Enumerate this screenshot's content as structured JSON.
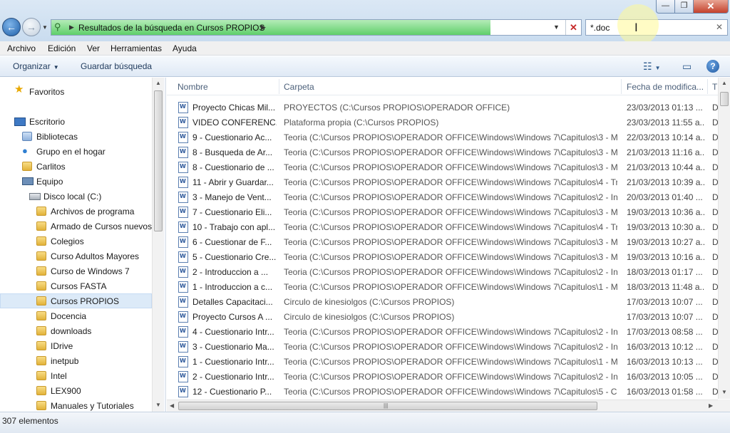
{
  "window": {
    "minimize_glyph": "—",
    "maximize_glyph": "❐",
    "close_glyph": "✕"
  },
  "navigation": {
    "back_glyph": "←",
    "forward_glyph": "→",
    "recent_glyph": "▼"
  },
  "address": {
    "icon": "search-folder-icon",
    "path_text": "Resultados de la búsqueda en Cursos PROPIOS",
    "separator": "▶",
    "dropdown_glyph": "▼",
    "stop_glyph": "✕"
  },
  "search": {
    "value": "*.doc",
    "clear_glyph": "✕"
  },
  "menu": [
    "Archivo",
    "Edición",
    "Ver",
    "Herramientas",
    "Ayuda"
  ],
  "commands": {
    "organize": "Organizar",
    "save_search": "Guardar búsqueda",
    "dropdown_glyph": "▼",
    "views_glyph": "☷",
    "preview_glyph": "▭",
    "help_glyph": "?"
  },
  "nav_tree": [
    {
      "label": "Favoritos",
      "icon": "star-icon"
    },
    {
      "label": "Escritorio",
      "icon": "desktop-icon"
    },
    {
      "label": "Bibliotecas",
      "icon": "libraries-icon"
    },
    {
      "label": "Grupo en el hogar",
      "icon": "homegroup-icon"
    },
    {
      "label": "Carlitos",
      "icon": "user-folder-icon"
    },
    {
      "label": "Equipo",
      "icon": "computer-icon"
    },
    {
      "label": "Disco local (C:)",
      "icon": "drive-icon"
    },
    {
      "label": "Archivos de programa",
      "icon": "folder-icon"
    },
    {
      "label": "Armado de Cursos nuevos",
      "icon": "folder-icon"
    },
    {
      "label": "Colegios",
      "icon": "folder-icon"
    },
    {
      "label": "Curso Adultos Mayores",
      "icon": "folder-icon"
    },
    {
      "label": "Curso de Windows 7",
      "icon": "folder-icon"
    },
    {
      "label": "Cursos FASTA",
      "icon": "folder-icon"
    },
    {
      "label": "Cursos PROPIOS",
      "icon": "folder-icon",
      "selected": true
    },
    {
      "label": "Docencia",
      "icon": "folder-icon"
    },
    {
      "label": "downloads",
      "icon": "folder-icon"
    },
    {
      "label": "IDrive",
      "icon": "folder-icon"
    },
    {
      "label": "inetpub",
      "icon": "folder-icon"
    },
    {
      "label": "Intel",
      "icon": "folder-icon"
    },
    {
      "label": "LEX900",
      "icon": "folder-icon"
    },
    {
      "label": "Manuales y Tutoriales",
      "icon": "folder-icon"
    }
  ],
  "columns": [
    "Nombre",
    "Carpeta",
    "Fecha de modifica...",
    "T"
  ],
  "files": [
    {
      "name": "Proyecto Chicas Mil...",
      "folder": "PROYECTOS (C:\\Cursos PROPIOS\\OPERADOR OFFICE)",
      "date": "23/03/2013 01:13 ...",
      "type": "D"
    },
    {
      "name": "VIDEO CONFERENC...",
      "folder": "Plataforma propia (C:\\Cursos PROPIOS)",
      "date": "23/03/2013 11:55 a...",
      "type": "D"
    },
    {
      "name": "9 - Cuestionario Ac...",
      "folder": "Teoria (C:\\Cursos PROPIOS\\OPERADOR OFFICE\\Windows\\Windows 7\\Capitulos\\3 - M...",
      "date": "22/03/2013 10:14 a...",
      "type": "D"
    },
    {
      "name": "8 - Busqueda de Ar...",
      "folder": "Teoria (C:\\Cursos PROPIOS\\OPERADOR OFFICE\\Windows\\Windows 7\\Capitulos\\3 - M...",
      "date": "21/03/2013 11:16 a...",
      "type": "D"
    },
    {
      "name": "8 - Cuestionario de ...",
      "folder": "Teoria (C:\\Cursos PROPIOS\\OPERADOR OFFICE\\Windows\\Windows 7\\Capitulos\\3 - M...",
      "date": "21/03/2013 10:44 a...",
      "type": "D"
    },
    {
      "name": "11 - Abrir y Guardar...",
      "folder": "Teoria (C:\\Cursos PROPIOS\\OPERADOR OFFICE\\Windows\\Windows 7\\Capitulos\\4 - Tr...",
      "date": "21/03/2013 10:39 a...",
      "type": "D"
    },
    {
      "name": "3 - Manejo de Vent...",
      "folder": "Teoria (C:\\Cursos PROPIOS\\OPERADOR OFFICE\\Windows\\Windows 7\\Capitulos\\2 - Int...",
      "date": "20/03/2013 01:40 ...",
      "type": "D"
    },
    {
      "name": "7 - Cuestionario Eli...",
      "folder": "Teoria (C:\\Cursos PROPIOS\\OPERADOR OFFICE\\Windows\\Windows 7\\Capitulos\\3 - M...",
      "date": "19/03/2013 10:36 a...",
      "type": "D"
    },
    {
      "name": "10 - Trabajo con apl...",
      "folder": "Teoria (C:\\Cursos PROPIOS\\OPERADOR OFFICE\\Windows\\Windows 7\\Capitulos\\4 - Tr...",
      "date": "19/03/2013 10:30 a...",
      "type": "D"
    },
    {
      "name": "6 - Cuestionar de F...",
      "folder": "Teoria (C:\\Cursos PROPIOS\\OPERADOR OFFICE\\Windows\\Windows 7\\Capitulos\\3 - M...",
      "date": "19/03/2013 10:27 a...",
      "type": "D"
    },
    {
      "name": "5 - Cuestionario Cre...",
      "folder": "Teoria (C:\\Cursos PROPIOS\\OPERADOR OFFICE\\Windows\\Windows 7\\Capitulos\\3 - M...",
      "date": "19/03/2013 10:16 a...",
      "type": "D"
    },
    {
      "name": "2 - Introduccion a ...",
      "folder": "Teoria (C:\\Cursos PROPIOS\\OPERADOR OFFICE\\Windows\\Windows 7\\Capitulos\\2 - Int...",
      "date": "18/03/2013 01:17 ...",
      "type": "D"
    },
    {
      "name": "1 - Introduccion a c...",
      "folder": "Teoria (C:\\Cursos PROPIOS\\OPERADOR OFFICE\\Windows\\Windows 7\\Capitulos\\1 - M...",
      "date": "18/03/2013 11:48 a...",
      "type": "D"
    },
    {
      "name": "Detalles Capacitaci...",
      "folder": "Circulo de kinesiolgos (C:\\Cursos PROPIOS)",
      "date": "17/03/2013 10:07 ...",
      "type": "D"
    },
    {
      "name": "Proyecto Cursos A ...",
      "folder": "Circulo de kinesiolgos (C:\\Cursos PROPIOS)",
      "date": "17/03/2013 10:07 ...",
      "type": "D"
    },
    {
      "name": "4 - Cuestionario Intr...",
      "folder": "Teoria (C:\\Cursos PROPIOS\\OPERADOR OFFICE\\Windows\\Windows 7\\Capitulos\\2 - Int...",
      "date": "17/03/2013 08:58 ...",
      "type": "D"
    },
    {
      "name": "3 - Cuestionario Ma...",
      "folder": "Teoria (C:\\Cursos PROPIOS\\OPERADOR OFFICE\\Windows\\Windows 7\\Capitulos\\2 - Int...",
      "date": "16/03/2013 10:12 ...",
      "type": "D"
    },
    {
      "name": "1 - Cuestionario Intr...",
      "folder": "Teoria (C:\\Cursos PROPIOS\\OPERADOR OFFICE\\Windows\\Windows 7\\Capitulos\\1 - M...",
      "date": "16/03/2013 10:13 ...",
      "type": "D"
    },
    {
      "name": "2 - Cuestionario Intr...",
      "folder": "Teoria (C:\\Cursos PROPIOS\\OPERADOR OFFICE\\Windows\\Windows 7\\Capitulos\\2 - Int...",
      "date": "16/03/2013 10:05 ...",
      "type": "D"
    },
    {
      "name": "12 - Cuestionario P...",
      "folder": "Teoria (C:\\Cursos PROPIOS\\OPERADOR OFFICE\\Windows\\Windows 7\\Capitulos\\5 - C...",
      "date": "16/03/2013 01:58 ...",
      "type": "D"
    }
  ],
  "scroll": {
    "up_glyph": "▲",
    "down_glyph": "▼",
    "left_glyph": "◀",
    "right_glyph": "▶",
    "grip_glyph": "|||"
  },
  "status": {
    "item_count": "307 elementos"
  },
  "colors": {
    "search_progress": "#5fcf6a",
    "selection": "#dceaf8",
    "header_text": "#4c607a"
  }
}
